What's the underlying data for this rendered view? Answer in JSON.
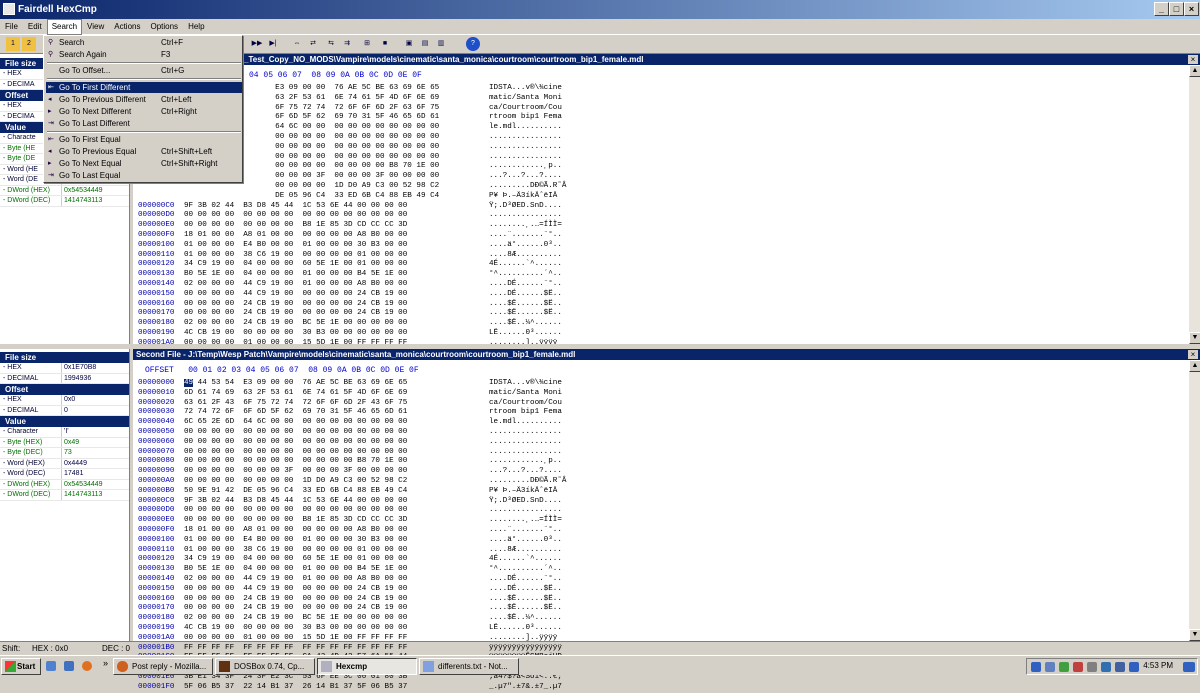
{
  "window": {
    "title": "Fairdell HexCmp",
    "minimize": "_",
    "maximize": "□",
    "close": "×"
  },
  "menu": {
    "items": [
      "File",
      "Edit",
      "Search",
      "View",
      "Actions",
      "Options",
      "Help"
    ]
  },
  "search_menu": {
    "items": [
      {
        "label": "Search",
        "shortcut": "Ctrl+F"
      },
      {
        "label": "Search Again",
        "shortcut": "F3"
      },
      {
        "label": "Go To Offset...",
        "shortcut": "Ctrl+G"
      },
      {
        "label": "Go To First Different",
        "shortcut": ""
      },
      {
        "label": "Go To Previous Different",
        "shortcut": "Ctrl+Left"
      },
      {
        "label": "Go To Next Different",
        "shortcut": "Ctrl+Right"
      },
      {
        "label": "Go To Last Different",
        "shortcut": ""
      },
      {
        "label": "Go To First Equal",
        "shortcut": ""
      },
      {
        "label": "Go To Previous Equal",
        "shortcut": "Ctrl+Shift+Left"
      },
      {
        "label": "Go To Next Equal",
        "shortcut": "Ctrl+Shift+Right"
      },
      {
        "label": "Go To Last Equal",
        "shortcut": ""
      }
    ]
  },
  "props1": {
    "file_size": "File size",
    "rows": [
      {
        "k": "- HEX",
        "v": ""
      },
      {
        "k": "- DECIMA",
        "v": ""
      }
    ],
    "offset": "Offset",
    "offset_rows": [
      {
        "k": "- HEX",
        "v": ""
      },
      {
        "k": "- DECIMA",
        "v": ""
      }
    ],
    "value": "Value",
    "value_rows": [
      {
        "k": "- Characte",
        "v": ""
      },
      {
        "k": "- Byte (HE",
        "v": ""
      },
      {
        "k": "- Byte (DE",
        "v": ""
      },
      {
        "k": "- Word (HE",
        "v": ""
      },
      {
        "k": "- Word (DE",
        "v": ""
      },
      {
        "k": "- DWord (HEX)",
        "v": "0x54534449"
      },
      {
        "k": "- DWord (DEC)",
        "v": "1414743113"
      }
    ]
  },
  "props2": {
    "file_size": "File size",
    "rows": [
      {
        "k": "- HEX",
        "v": "0x1E70B8"
      },
      {
        "k": "- DECIMAL",
        "v": "1994936"
      }
    ],
    "offset": "Offset",
    "offset_rows": [
      {
        "k": "- HEX",
        "v": "0x0"
      },
      {
        "k": "- DECIMAL",
        "v": "0"
      }
    ],
    "value": "Value",
    "value_rows": [
      {
        "k": "- Character",
        "v": "'I'"
      },
      {
        "k": "- Byte (HEX)",
        "v": "0x49"
      },
      {
        "k": "- Byte (DEC)",
        "v": "73"
      },
      {
        "k": "- Word (HEX)",
        "v": "0x4449"
      },
      {
        "k": "- Word (DEC)",
        "v": "17481"
      },
      {
        "k": "- DWord (HEX)",
        "v": "0x54534449"
      },
      {
        "k": "- DWord (DEC)",
        "v": "1414743113"
      }
    ]
  },
  "first_file": {
    "title": "_Test_Copy_NO_MODS\\Vampire\\models\\cinematic\\santa_monica\\courtroom\\courtroom_bip1_female.mdl",
    "header": "04 05 06 07  08 09 0A 0B 0C 0D 0E 0F",
    "rows": [
      {
        "o": "",
        "h": "                    E3 09 00 00  76 AE 5C BE 63 69 6E 65",
        "a": "IDSTA...v®\\¾cine"
      },
      {
        "o": "",
        "h": "                    63 2F 53 61  6E 74 61 5F 4D 6F 6E 69",
        "a": "matic/Santa Moni"
      },
      {
        "o": "",
        "h": "                    6F 75 72 74  72 6F 6F 6D 2F 63 6F 75",
        "a": "ca/Courtroom/Cou"
      },
      {
        "o": "",
        "h": "                    6F 6D 5F 62  69 70 31 5F 46 65 6D 61",
        "a": "rtroom bip1 Fema"
      },
      {
        "o": "",
        "h": "                    64 6C 00 00  00 00 00 00 00 00 00 00",
        "a": "le.mdl.........."
      },
      {
        "o": "",
        "h": "                    00 00 00 00  00 00 00 00 00 00 00 00",
        "a": "................"
      },
      {
        "o": "",
        "h": "                    00 00 00 00  00 00 00 00 00 00 00 00",
        "a": "................"
      },
      {
        "o": "",
        "h": "                    00 00 00 00  00 00 00 00 00 00 00 00",
        "a": "................"
      },
      {
        "o": "",
        "h": "                    00 00 00 00  00 00 00 00 B8 70 1E 00",
        "a": "............¸p.."
      },
      {
        "o": "",
        "h": "                    00 00 00 3F  00 00 00 3F 00 00 00 00",
        "a": "...?...?...?...."
      },
      {
        "o": "",
        "h": "                    00 00 00 00  1D D0 A9 C3 00 52 98 C2",
        "a": ".........DÐ©Ã.R˜Â"
      },
      {
        "o": "",
        "h": "                    DE 05 96 C4  33 ED 6B C4 88 EB 49 C4",
        "a": "P¥ Þ.–Ä3íkÄˆëIÄ"
      },
      {
        "o": "000000C0",
        "h": "9F 3B 02 44  B3 D8 45 44  1C 53 6E 44 00 00 00 00",
        "a": "Ÿ;.D³ØED.SnD...."
      },
      {
        "o": "000000D0",
        "h": "00 00 00 00  00 00 00 00  00 00 00 00 00 00 00 00",
        "a": "................"
      },
      {
        "o": "000000E0",
        "h": "00 00 00 00  00 00 00 00  B8 1E 85 3D CD CC CC 3D",
        "a": "........¸.…=ÍÌÌ="
      },
      {
        "o": "000000F0",
        "h": "18 01 00 00  A8 01 00 00  00 00 00 00 A8 B0 00 00",
        "a": "....¨.......¨°.."
      },
      {
        "o": "00000100",
        "h": "01 00 00 00  E4 B0 00 00  01 00 00 00 30 B3 00 00",
        "a": "....ä°......0³.."
      },
      {
        "o": "00000110",
        "h": "01 00 00 00  38 C6 19 00  00 00 00 00 01 00 00 00",
        "a": "....8Æ.........."
      },
      {
        "o": "00000120",
        "h": "34 C9 19 00  04 00 00 00  60 5E 1E 00 01 00 00 00",
        "a": "4É......`^......"
      },
      {
        "o": "00000130",
        "h": "B0 5E 1E 00  04 00 00 00  01 00 00 00 B4 5E 1E 00",
        "a": "°^..........´^.."
      },
      {
        "o": "00000140",
        "h": "02 00 00 00  44 C9 19 00  01 00 00 00 A8 B0 00 00",
        "a": "....DÉ......¨°.."
      },
      {
        "o": "00000150",
        "h": "00 00 00 00  44 C9 19 00  00 00 00 00 24 CB 19 00",
        "a": "....DÉ......$Ë.."
      },
      {
        "o": "00000160",
        "h": "00 00 00 00  24 CB 19 00  00 00 00 00 24 CB 19 00",
        "a": "....$Ë......$Ë.."
      },
      {
        "o": "00000170",
        "h": "00 00 00 00  24 CB 19 00  00 00 00 00 24 CB 19 00",
        "a": "....$Ë......$Ë.."
      },
      {
        "o": "00000180",
        "h": "02 00 00 00  24 CB 19 00  BC 5E 1E 00 00 00 00 00",
        "a": "....$Ë..¼^......"
      },
      {
        "o": "00000190",
        "h": "4C CB 19 00  00 00 00 00  30 B3 00 00 00 00 00 00",
        "a": "LË......0³......"
      },
      {
        "o": "000001A0",
        "h": "00 00 00 00  01 00 00 00  15 5D 1E 00 FF FF FF FF",
        "a": "........]..ÿÿÿÿ"
      },
      {
        "o": "000001B0",
        "h": "FF FF FF FF  FF FF FF FF  FF FF FF FF FF FF FF FF",
        "a": "ÿÿÿÿÿÿÿÿÿÿÿÿÿÿÿÿ"
      },
      {
        "o": "000001C0",
        "h": "FF FF FF FF  FF FF FF FF  CA 43 4D 42 E7 6A 55 44",
        "a": "ÿÿÿÿÿÿÿÿÊCMBçjUD"
      },
      {
        "o": "000001D0",
        "h": "C2 92 1B 42  37 E1 34 3F  EA 6A E3 3C EF 6A E3 3C",
        "a": "Â'.B7á4?êjã<ïjã<"
      },
      {
        "o": "000001E0",
        "h": "3B E1 34 3F  24 3F E2 3C  53 6F EE 3C 00 01 80 3B",
        "a": ";á4?$?â<Soî<..€;"
      },
      {
        "o": "000001F0",
        "h": "5F 06 B5 37  22 14 B1 37  26 14 B1 37 5F 06 B5 37",
        "a": "_.µ7\".±7&.±7_.µ7"
      }
    ]
  },
  "second_file": {
    "title": "Second File - J:\\Temp\\Wesp Patch\\Vampire\\models\\cinematic\\santa_monica\\courtroom\\courtroom_bip1_female.mdl",
    "header": "OFFSET   00 01 02 03 04 05 06 07  08 09 0A 0B 0C 0D 0E 0F",
    "rows": [
      {
        "o": "00000000",
        "h": "49 44 53 54  E3 09 00 00  76 AE 5C BE 63 69 6E 65",
        "a": "IDSTA...v®\\¾cine"
      },
      {
        "o": "00000010",
        "h": "6D 61 74 69  63 2F 53 61  6E 74 61 5F 4D 6F 6E 69",
        "a": "matic/Santa Moni"
      },
      {
        "o": "00000020",
        "h": "63 61 2F 43  6F 75 72 74  72 6F 6F 6D 2F 43 6F 75",
        "a": "ca/Courtroom/Cou"
      },
      {
        "o": "00000030",
        "h": "72 74 72 6F  6F 6D 5F 62  69 70 31 5F 46 65 6D 61",
        "a": "rtroom bip1 Fema"
      },
      {
        "o": "00000040",
        "h": "6C 65 2E 6D  64 6C 00 00  00 00 00 00 00 00 00 00",
        "a": "le.mdl.........."
      },
      {
        "o": "00000050",
        "h": "00 00 00 00  00 00 00 00  00 00 00 00 00 00 00 00",
        "a": "................"
      },
      {
        "o": "00000060",
        "h": "00 00 00 00  00 00 00 00  00 00 00 00 00 00 00 00",
        "a": "................"
      },
      {
        "o": "00000070",
        "h": "00 00 00 00  00 00 00 00  00 00 00 00 00 00 00 00",
        "a": "................"
      },
      {
        "o": "00000080",
        "h": "00 00 00 00  00 00 00 00  00 00 00 00 B8 70 1E 00",
        "a": "............¸p.."
      },
      {
        "o": "00000090",
        "h": "00 00 00 00  00 00 00 3F  00 00 00 3F 00 00 00 00",
        "a": "...?...?...?...."
      },
      {
        "o": "000000A0",
        "h": "00 00 00 00  00 00 00 00  1D D0 A9 C3 00 52 98 C2",
        "a": ".........DÐ©Ã.R˜Â"
      },
      {
        "o": "000000B0",
        "h": "50 9E 91 42  DE 05 96 C4  33 ED 6B C4 88 EB 49 C4",
        "a": "P¥ Þ.–Ä3íkÄˆëIÄ"
      },
      {
        "o": "000000C0",
        "h": "9F 3B 02 44  B3 D8 45 44  1C 53 6E 44 00 00 00 00",
        "a": "Ÿ;.D³ØED.SnD...."
      },
      {
        "o": "000000D0",
        "h": "00 00 00 00  00 00 00 00  00 00 00 00 00 00 00 00",
        "a": "................"
      },
      {
        "o": "000000E0",
        "h": "00 00 00 00  00 00 00 00  B8 1E 85 3D CD CC CC 3D",
        "a": "........¸.…=ÍÌÌ="
      },
      {
        "o": "000000F0",
        "h": "18 01 00 00  A8 01 00 00  00 00 00 00 A8 B0 00 00",
        "a": "....¨.......¨°.."
      },
      {
        "o": "00000100",
        "h": "01 00 00 00  E4 B0 00 00  01 00 00 00 30 B3 00 00",
        "a": "....ä°......0³.."
      },
      {
        "o": "00000110",
        "h": "01 00 00 00  38 C6 19 00  00 00 00 00 01 00 00 00",
        "a": "....8Æ.........."
      },
      {
        "o": "00000120",
        "h": "34 C9 19 00  04 00 00 00  60 5E 1E 00 01 00 00 00",
        "a": "4É......`^......"
      },
      {
        "o": "00000130",
        "h": "B0 5E 1E 00  04 00 00 00  01 00 00 00 B4 5E 1E 00",
        "a": "°^..........´^.."
      },
      {
        "o": "00000140",
        "h": "02 00 00 00  44 C9 19 00  01 00 00 00 A8 B0 00 00",
        "a": "....DÉ......¨°.."
      },
      {
        "o": "00000150",
        "h": "00 00 00 00  44 C9 19 00  00 00 00 00 24 CB 19 00",
        "a": "....DÉ......$Ë.."
      },
      {
        "o": "00000160",
        "h": "00 00 00 00  24 CB 19 00  00 00 00 00 24 CB 19 00",
        "a": "....$Ë......$Ë.."
      },
      {
        "o": "00000170",
        "h": "00 00 00 00  24 CB 19 00  00 00 00 00 24 CB 19 00",
        "a": "....$Ë......$Ë.."
      },
      {
        "o": "00000180",
        "h": "02 00 00 00  24 CB 19 00  BC 5E 1E 00 00 00 00 00",
        "a": "....$Ë..¼^......"
      },
      {
        "o": "00000190",
        "h": "4C CB 19 00  00 00 00 00  30 B3 00 00 00 00 00 00",
        "a": "LË......0³......"
      },
      {
        "o": "000001A0",
        "h": "00 00 00 00  01 00 00 00  15 5D 1E 00 FF FF FF FF",
        "a": "........]..ÿÿÿÿ"
      },
      {
        "o": "000001B0",
        "h": "FF FF FF FF  FF FF FF FF  FF FF FF FF FF FF FF FF",
        "a": "ÿÿÿÿÿÿÿÿÿÿÿÿÿÿÿÿ"
      },
      {
        "o": "000001C0",
        "h": "FF FF FF FF  FF FF FF FF  CA 43 4D 42 E7 6A 55 44",
        "a": "ÿÿÿÿÿÿÿÿÊCMBçjUD"
      },
      {
        "o": "000001D0",
        "h": "C2 92 1B 42  37 E1 34 3F  EA 6A E3 3C EF 6A E3 3C",
        "a": "Â'.B7á4?êjã<ïjã<"
      },
      {
        "o": "000001E0",
        "h": "3B E1 34 3F  24 3F E2 3C  53 6F EE 3C 00 01 80 3B",
        "a": ";á4?$?â<Soî<..€;"
      },
      {
        "o": "000001F0",
        "h": "5F 06 B5 37  22 14 B1 37  26 14 B1 37 5F 06 B5 37",
        "a": "_.µ7\".±7&.±7_.µ7"
      }
    ]
  },
  "status": {
    "shift": "Shift:",
    "hex": "HEX : 0x0",
    "dec": "DEC : 0"
  },
  "taskbar": {
    "start": "Start",
    "chevron": "»",
    "buttons": [
      "Post reply - Mozilla...",
      "DOSBox 0.74, Cp...",
      "Hexcmp",
      "differents.txt - Not..."
    ],
    "clock": "4:53 PM"
  },
  "colors": {
    "title_blue": "#0a246a",
    "offset_blue": "#0000aa",
    "green": "#007000"
  }
}
